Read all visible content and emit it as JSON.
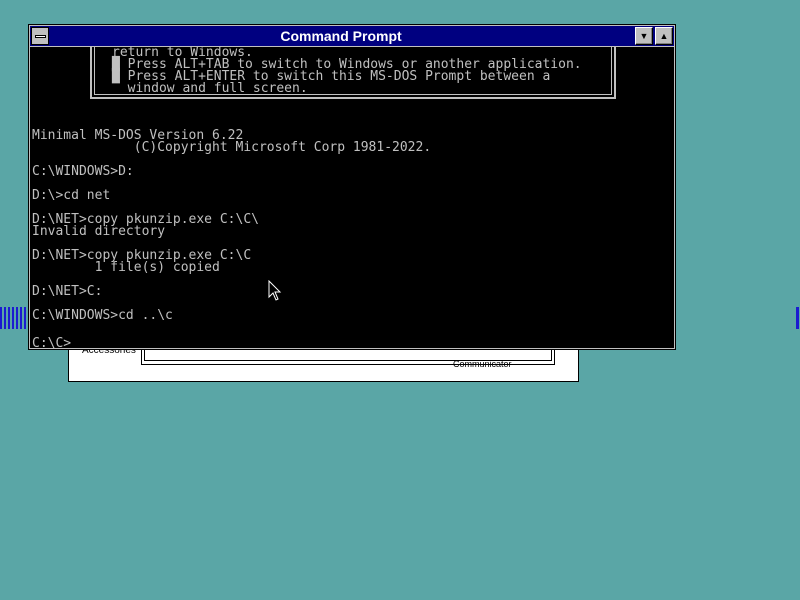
{
  "background_window": {
    "label_left": "Accessories",
    "label_right": "Communicator"
  },
  "window": {
    "title": "Command Prompt",
    "minimize_glyph": "▼",
    "maximize_glyph": "▲"
  },
  "info_lines": [
    "return to Windows.",
    "█ Press ALT+TAB to switch to Windows or another application.",
    "█ Press ALT+ENTER to switch this MS-DOS Prompt between a",
    "  window and full screen."
  ],
  "console_lines": [
    "Minimal MS-DOS Version 6.22",
    "             (C)Copyright Microsoft Corp 1981-2022.",
    "",
    "C:\\WINDOWS>D:",
    "",
    "D:\\>cd net",
    "",
    "D:\\NET>copy pkunzip.exe C:\\C\\",
    "Invalid directory",
    "",
    "D:\\NET>copy pkunzip.exe C:\\C",
    "        1 file(s) copied",
    "",
    "D:\\NET>C:",
    "",
    "C:\\WINDOWS>cd ..\\c",
    ""
  ],
  "prompt": "C:\\C>",
  "colors": {
    "desktop": "#5aa6a6",
    "titlebar": "#000080",
    "console_bg": "#000000",
    "console_fg": "#c0c0c0"
  }
}
